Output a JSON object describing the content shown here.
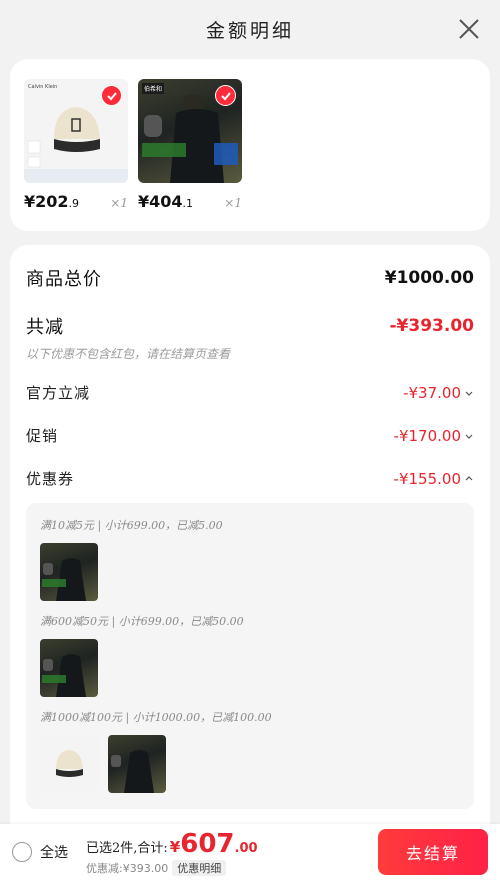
{
  "header": {
    "title": "金额明细"
  },
  "products": [
    {
      "brand": "Calvin Klein",
      "price_int": "¥202",
      "price_dec": ".9",
      "qty": "×1",
      "selected": true
    },
    {
      "brand": "伯希和",
      "price_int": "¥404",
      "price_dec": ".1",
      "qty": "×1",
      "selected": true
    }
  ],
  "summary": {
    "total_label": "商品总价",
    "total_value": "¥1000.00",
    "discount_label": "共减",
    "discount_value": "-¥393.00",
    "note": "以下优惠不包含红包，请在结算页查看",
    "official_label": "官方立减",
    "official_value": "-¥37.00",
    "promo_label": "促销",
    "promo_value": "-¥170.00",
    "coupon_label": "优惠券",
    "coupon_value": "-¥155.00"
  },
  "coupons": [
    {
      "text": "满10减5元 | 小计699.00，已减5.00"
    },
    {
      "text": "满600减50元 | 小计699.00，已减50.00"
    },
    {
      "text": "满1000减100元 | 小计1000.00，已减100.00"
    }
  ],
  "bottom": {
    "select_all": "全选",
    "selected_summary": "已选2件,合计:",
    "yen": "¥",
    "total_int": "607",
    "total_dec": ".00",
    "discount_text": "优惠减:¥393.00",
    "detail_chip": "优惠明细",
    "checkout": "去结算"
  },
  "colors": {
    "accent": "#e8252e",
    "button": "#ff2a3a"
  }
}
